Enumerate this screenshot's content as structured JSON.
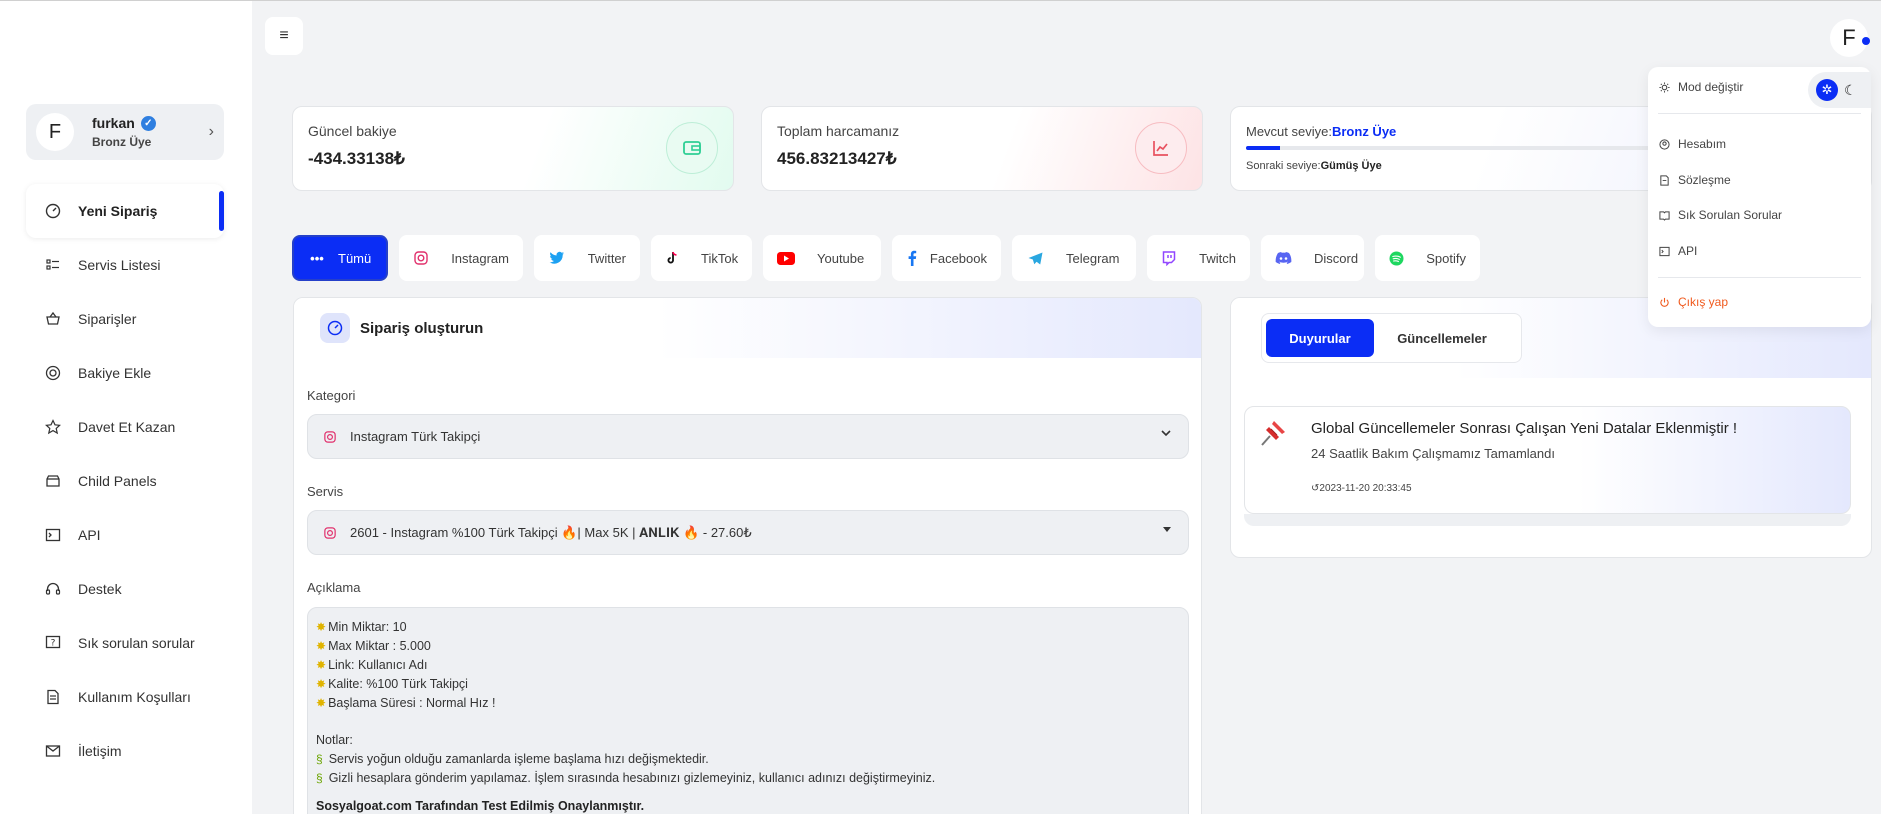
{
  "user": {
    "initial": "F",
    "name": "furkan",
    "level": "Bronz Üye",
    "verified_mark": "✓"
  },
  "sidebar": {
    "items": [
      {
        "label": "Yeni Sipariş",
        "icon": "gauge-icon"
      },
      {
        "label": "Servis Listesi",
        "icon": "list-icon"
      },
      {
        "label": "Siparişler",
        "icon": "basket-icon"
      },
      {
        "label": "Bakiye Ekle",
        "icon": "coin-icon"
      },
      {
        "label": "Davet Et Kazan",
        "icon": "star-icon"
      },
      {
        "label": "Child Panels",
        "icon": "store-icon"
      },
      {
        "label": "API",
        "icon": "terminal-icon"
      },
      {
        "label": "Destek",
        "icon": "headset-icon"
      },
      {
        "label": "Sık sorulan sorular",
        "icon": "help-icon"
      },
      {
        "label": "Kullanım Koşulları",
        "icon": "document-icon"
      },
      {
        "label": "İletişim",
        "icon": "mail-icon"
      }
    ]
  },
  "topbar": {
    "menu_glyph": "≡",
    "user_initial": "F"
  },
  "stats": {
    "balance_label": "Güncel bakiye",
    "balance_value": "-434.33138₺",
    "spent_label": "Toplam harcamanız",
    "spent_value": "456.83213427₺",
    "level_label": "Mevcut seviye:",
    "level_value": "Bronz Üye",
    "level_progress": 0.08,
    "next_label": "Sonraki seviye:",
    "next_value": "Gümüş Üye"
  },
  "platform_tabs": [
    {
      "label": "Tümü",
      "icon": "dots-icon"
    },
    {
      "label": "Instagram",
      "icon": "instagram-icon"
    },
    {
      "label": "Twitter",
      "icon": "twitter-icon"
    },
    {
      "label": "TikTok",
      "icon": "tiktok-icon"
    },
    {
      "label": "Youtube",
      "icon": "youtube-icon"
    },
    {
      "label": "Facebook",
      "icon": "facebook-icon"
    },
    {
      "label": "Telegram",
      "icon": "telegram-icon"
    },
    {
      "label": "Twitch",
      "icon": "twitch-icon"
    },
    {
      "label": "Discord",
      "icon": "discord-icon"
    },
    {
      "label": "Spotify",
      "icon": "spotify-icon"
    }
  ],
  "order": {
    "title": "Sipariş oluşturun",
    "category_label": "Kategori",
    "category_value": "Instagram Türk Takipçi",
    "service_label": "Servis",
    "service_value": "2601 - Instagram %100 Türk Takipçi 🔥| Max 5K | 𝐀𝐍𝐋𝐈𝐊 🔥 - 27.60₺",
    "description_label": "Açıklama",
    "description_lines": [
      "Min Miktar: 10",
      "Max Miktar : 5.000",
      "Link: Kullanıcı Adı",
      "Kalite: %100 Türk Takipçi",
      "Başlama Süresi : Normal Hız !"
    ],
    "notes_label": "Notlar:",
    "notes": [
      "Servis yoğun olduğu zamanlarda işleme başlama hızı değişmektedir.",
      "Gizli hesaplara gönderim yapılamaz. İşlem sırasında hesabınızı gizlemeyiniz, kullanıcı adınızı değiştirmeyiniz."
    ],
    "footer_text": "Sosyalgoat.com Tarafından Test Edilmiş Onaylanmıştır."
  },
  "news": {
    "tab_active": "Duyurular",
    "tab_other": "Güncellemeler",
    "item_title": "Global Güncellemeler Sonrası Çalışan Yeni Datalar Eklenmiştir !",
    "item_subtitle": "24 Saatlik Bakım Çalışmamız Tamamlandı",
    "item_date": "2023-11-20 20:33:45"
  },
  "dropdown": {
    "mode_label": "Mod değiştir",
    "items": [
      "Hesabım",
      "Sözleşme",
      "Sık Sorulan Sorular",
      "API"
    ],
    "logout": "Çıkış yap"
  },
  "colors": {
    "accent": "#0b2df5",
    "logout": "#f05a1e",
    "balance_icon": "#2ecf95",
    "spent_icon": "#e8515f"
  }
}
